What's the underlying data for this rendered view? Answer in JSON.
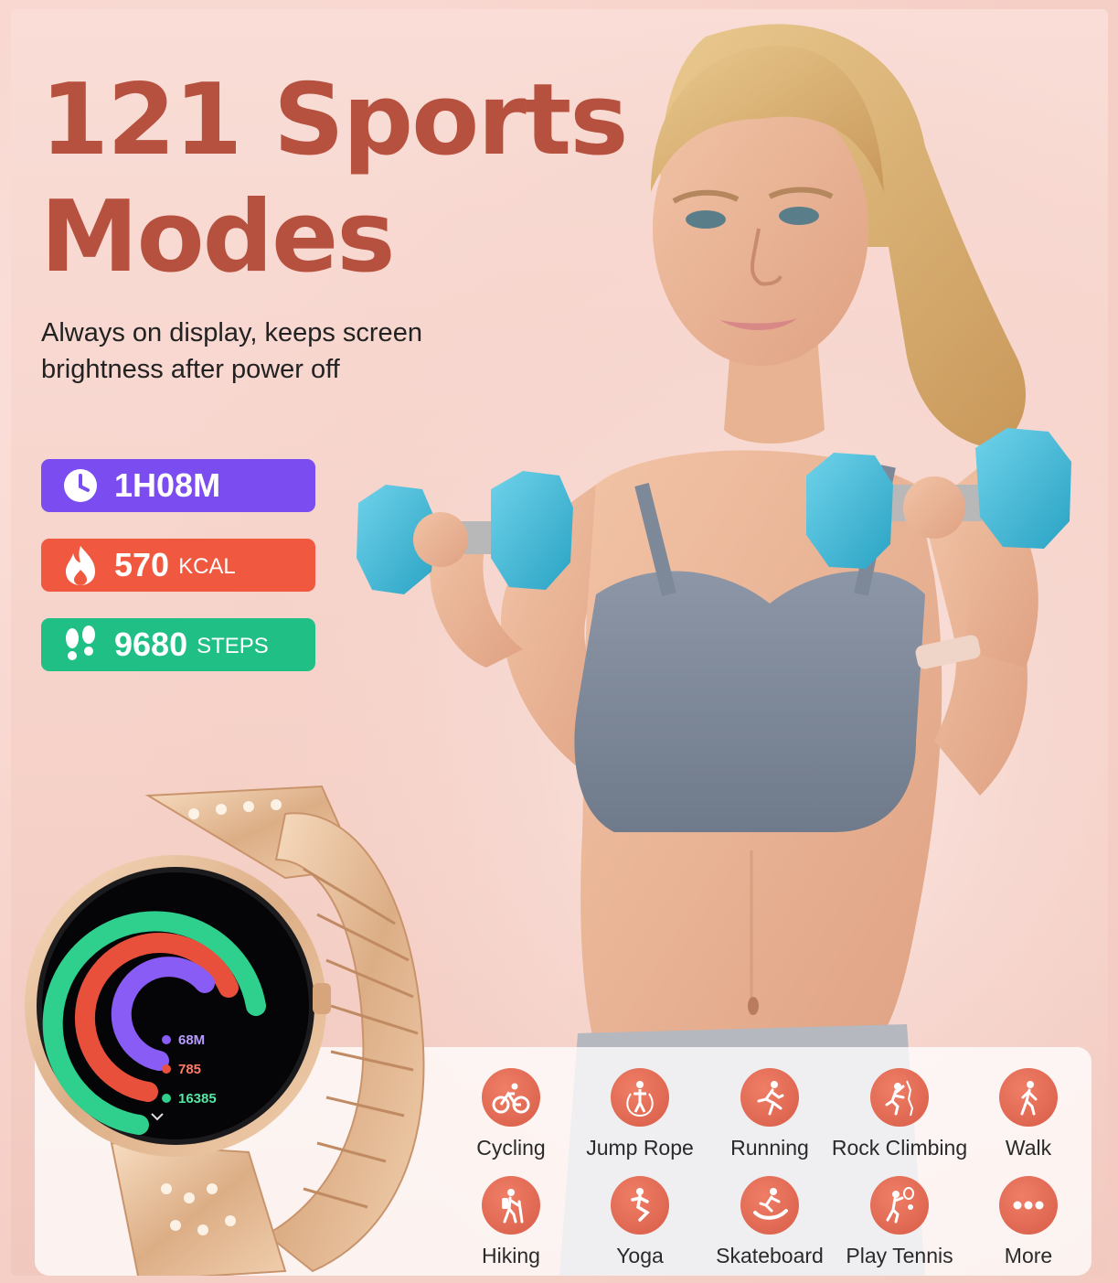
{
  "headline": {
    "line1": "121 Sports",
    "line2": "Modes"
  },
  "subtitle": {
    "line1": "Always on display, keeps screen",
    "line2": "brightness after power off"
  },
  "stats": [
    {
      "icon": "clock-icon",
      "value": "1H08M",
      "unit": "",
      "color": "#7b4df0"
    },
    {
      "icon": "flame-icon",
      "value": "570",
      "unit": "KCAL",
      "color": "#f0593f"
    },
    {
      "icon": "footsteps-icon",
      "value": "9680",
      "unit": "STEPS",
      "color": "#1fbf86"
    }
  ],
  "watch_screen": {
    "minutes": "68M",
    "calories": "785",
    "steps": "16385",
    "ring_colors": {
      "outer": "#2fd08e",
      "middle": "#e8503c",
      "inner": "#8a5cf6"
    }
  },
  "modes": [
    {
      "label": "Cycling",
      "icon": "bicycle-icon"
    },
    {
      "label": "Jump Rope",
      "icon": "jump-rope-icon"
    },
    {
      "label": "Running",
      "icon": "running-icon"
    },
    {
      "label": "Rock Climbing",
      "icon": "rock-climbing-icon"
    },
    {
      "label": "Walk",
      "icon": "walk-icon"
    },
    {
      "label": "Hiking",
      "icon": "hiking-icon"
    },
    {
      "label": "Yoga",
      "icon": "yoga-icon"
    },
    {
      "label": "Skateboard",
      "icon": "skateboard-icon"
    },
    {
      "label": "Play Tennis",
      "icon": "tennis-icon"
    },
    {
      "label": "More",
      "icon": "more-icon"
    }
  ],
  "colors": {
    "headline": "#b7513f",
    "mode_icon_bg": "#e06a52",
    "dumbbell": "#3fb8d6"
  }
}
